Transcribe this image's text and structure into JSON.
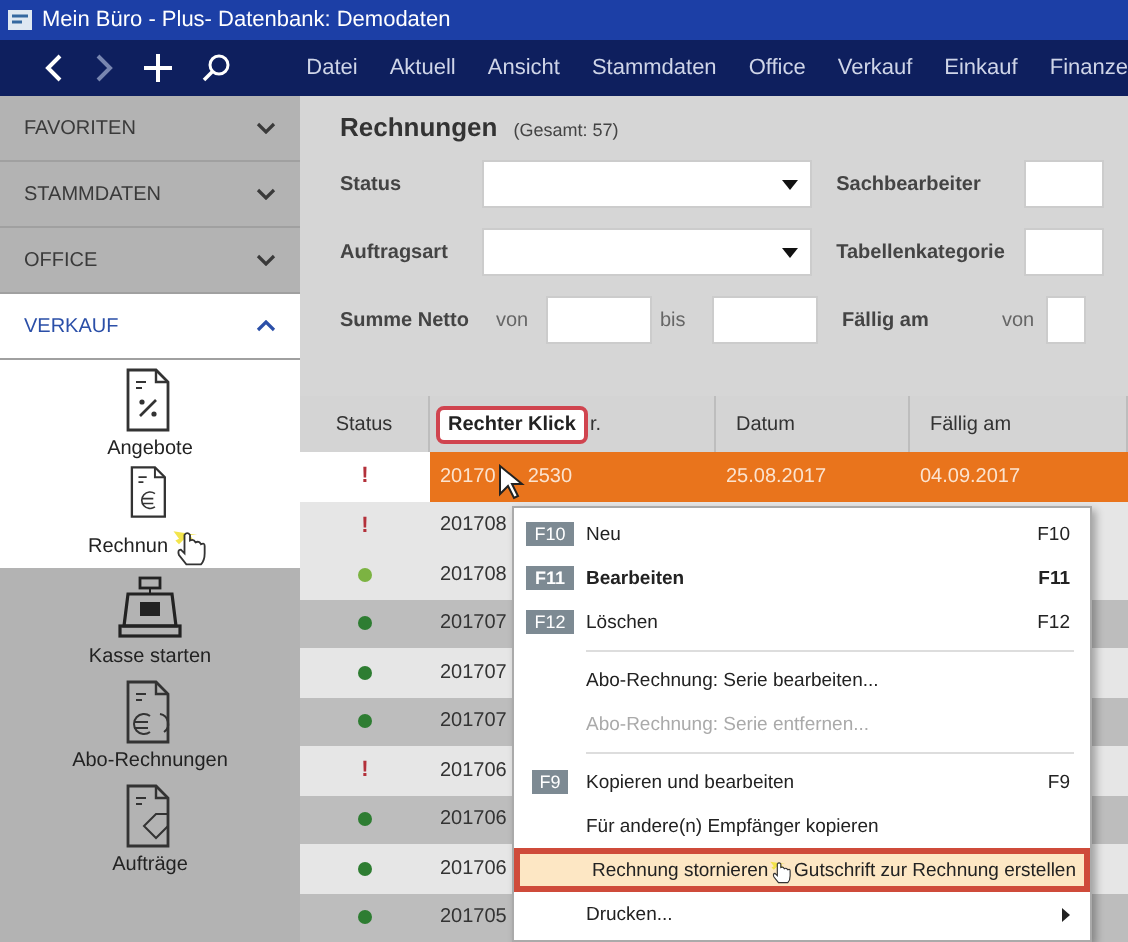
{
  "window": {
    "title": "Mein Büro - Plus- Datenbank: Demodaten"
  },
  "menu": [
    "Datei",
    "Aktuell",
    "Ansicht",
    "Stammdaten",
    "Office",
    "Verkauf",
    "Einkauf",
    "Finanze"
  ],
  "sidebar": [
    {
      "label": "FAVORITEN",
      "expanded": false
    },
    {
      "label": "STAMMDATEN",
      "expanded": false
    },
    {
      "label": "OFFICE",
      "expanded": false
    },
    {
      "label": "VERKAUF",
      "expanded": true,
      "items": [
        {
          "label": "Angebote",
          "kind": "offer",
          "highlighted": true
        },
        {
          "label": "Rechnun",
          "kind": "invoice",
          "highlighted": true,
          "clicked": true
        },
        {
          "label": "Kasse starten",
          "kind": "register",
          "highlighted": false
        },
        {
          "label": "Abo-Rechnungen",
          "kind": "subscription",
          "highlighted": false
        },
        {
          "label": "Aufträge",
          "kind": "order",
          "highlighted": false
        }
      ]
    }
  ],
  "page": {
    "title": "Rechnungen",
    "count": "(Gesamt: 57)"
  },
  "filters": {
    "status": "Status",
    "sachbearbeiter": "Sachbearbeiter",
    "auftragsart": "Auftragsart",
    "tabellenkategorie": "Tabellenkategorie",
    "summe": "Summe Netto",
    "von": "von",
    "bis": "bis",
    "faellig": "Fällig am",
    "faellig_von": "von"
  },
  "table": {
    "columns": [
      "Status",
      "r.",
      "Datum",
      "Fällig am"
    ],
    "rows": [
      {
        "kind": "warning",
        "mark": "!",
        "number": "20170",
        "number_tail": "2530",
        "date": "25.08.2017",
        "due": "04.09.2017",
        "selected": true
      },
      {
        "kind": "warning",
        "mark": "!",
        "number": "201708",
        "selected": false
      },
      {
        "kind": "dot",
        "color": "#7cb342",
        "number": "201708",
        "selected": false
      },
      {
        "kind": "dot",
        "color": "#2e7d32",
        "number": "201707",
        "selected": false
      },
      {
        "kind": "dot",
        "color": "#2e7d32",
        "number": "201707",
        "selected": false
      },
      {
        "kind": "dot",
        "color": "#2e7d32",
        "number": "201707",
        "selected": false
      },
      {
        "kind": "warning",
        "mark": "!",
        "number": "201706",
        "selected": false
      },
      {
        "kind": "dot",
        "color": "#2e7d32",
        "number": "201706",
        "selected": false
      },
      {
        "kind": "dot",
        "color": "#2e7d32",
        "number": "201706",
        "selected": false
      },
      {
        "kind": "dot",
        "color": "#2e7d32",
        "number": "201705",
        "selected": false
      }
    ]
  },
  "callout": "Rechter Klick",
  "context_menu": [
    {
      "kind": "item",
      "badge": "F10",
      "label": "Neu",
      "shortcut": "F10",
      "bold": false,
      "disabled": false
    },
    {
      "kind": "item",
      "badge": "F11",
      "label": "Bearbeiten",
      "shortcut": "F11",
      "bold": true,
      "disabled": false
    },
    {
      "kind": "item",
      "badge": "F12",
      "label": "Löschen",
      "shortcut": "F12",
      "bold": false,
      "disabled": false
    },
    {
      "kind": "separator"
    },
    {
      "kind": "item",
      "label": "Abo-Rechnung: Serie bearbeiten...",
      "bold": false,
      "disabled": false
    },
    {
      "kind": "item",
      "label": "Abo-Rechnung: Serie entfernen...",
      "bold": false,
      "disabled": true
    },
    {
      "kind": "separator"
    },
    {
      "kind": "item",
      "badge": "F9",
      "label": "Kopieren und bearbeiten",
      "shortcut": "F9",
      "bold": false,
      "disabled": false
    },
    {
      "kind": "item",
      "label": "Für andere(n) Empfänger kopieren",
      "bold": false,
      "disabled": false
    },
    {
      "kind": "item",
      "label": "Rechnung stornieren",
      "label_tail": "Gutschrift zur Rechnung erstellen",
      "bold": false,
      "disabled": false,
      "highlighted": true
    },
    {
      "kind": "item",
      "label": "Drucken...",
      "bold": false,
      "disabled": false,
      "submenu": true
    }
  ]
}
